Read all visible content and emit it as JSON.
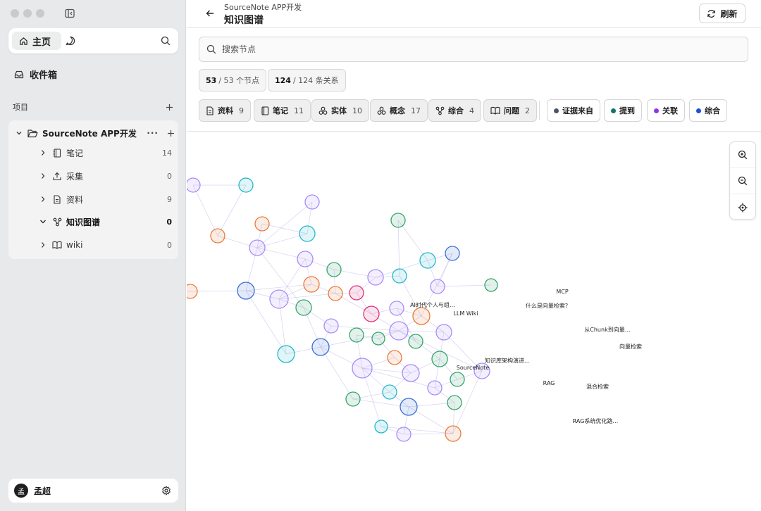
{
  "sidebar": {
    "home_label": "主页",
    "inbox_label": "收件箱",
    "projects_label": "项目",
    "project_name": "SourceNote APP开发",
    "tree": [
      {
        "label": "笔记",
        "count": "14"
      },
      {
        "label": "采集",
        "count": "0"
      },
      {
        "label": "资料",
        "count": "9"
      },
      {
        "label": "知识图谱",
        "count": "0"
      },
      {
        "label": "wiki",
        "count": "0"
      }
    ],
    "user_avatar": "孟",
    "user_name": "孟超"
  },
  "header": {
    "subtitle": "SourceNote APP开发",
    "title": "知识图谱",
    "refresh_label": "刷新"
  },
  "search": {
    "placeholder": "搜索节点"
  },
  "stats": {
    "nodes_shown": "53",
    "nodes_total": "/ 53 个节点",
    "edges_shown": "124",
    "edges_total": "/ 124 条关系"
  },
  "type_filters": [
    {
      "label": "资料",
      "count": "9",
      "icon": "document-icon"
    },
    {
      "label": "笔记",
      "count": "11",
      "icon": "notebook-icon"
    },
    {
      "label": "实体",
      "count": "10",
      "icon": "cubes-icon"
    },
    {
      "label": "概念",
      "count": "17",
      "icon": "cubes-icon"
    },
    {
      "label": "综合",
      "count": "4",
      "icon": "graph-icon"
    },
    {
      "label": "问题",
      "count": "2",
      "icon": "book-icon"
    }
  ],
  "relation_filters": [
    {
      "label": "证据来自",
      "color": "#4b5563"
    },
    {
      "label": "提到",
      "color": "#0f766e"
    },
    {
      "label": "关联",
      "color": "#9333ea"
    },
    {
      "label": "综合",
      "color": "#1d4ed8"
    }
  ],
  "graph": {
    "colors": {
      "purple": "#a78bfa",
      "cyan": "#22b8c8",
      "orange": "#ea7a3a",
      "green": "#34a36b",
      "blue": "#3b6fd9",
      "pink": "#e0307a"
    },
    "labels": {
      "ai": "AI时代个人与组…",
      "llmwiki": "LLM Wiki",
      "question": "什么是向量检索?",
      "mcp": "MCP",
      "chunk": "从Chunk到向量…",
      "vsearch": "向量检索",
      "kbarch": "知识库架构演进…",
      "sourcenote": "SourceNote",
      "rag": "RAG",
      "hybrid": "混合检索",
      "ragopt": "RAG系统优化路…"
    }
  }
}
